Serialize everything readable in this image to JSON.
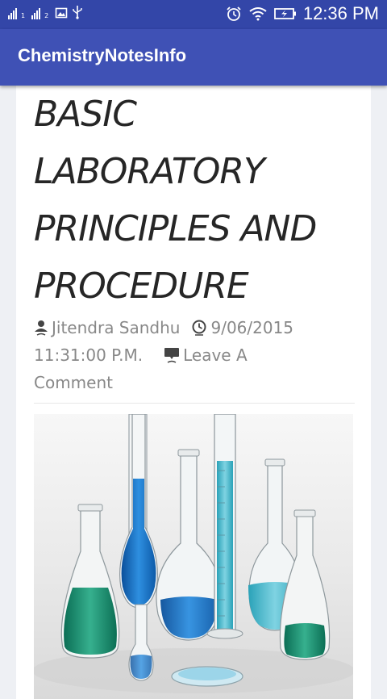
{
  "status_bar": {
    "time": "12:36 PM",
    "sim1": "1",
    "sim2": "2",
    "icons": [
      "signal-icon",
      "signal-icon",
      "image-icon",
      "usb-icon",
      "alarm-icon",
      "wifi-icon",
      "battery-charging-icon"
    ]
  },
  "app_bar": {
    "title": "ChemistryNotesInfo"
  },
  "post": {
    "title_lines": [
      "BASIC",
      "LABORATORY",
      "PRINCIPLES AND",
      "PROCEDURE"
    ],
    "author": "Jitendra Sandhu",
    "date_part1": "9/06/2015",
    "date_part2": "11:31:00 P.M.",
    "comment_part1": "Leave A",
    "comment_part2": "Comment",
    "image_subject": "laboratory glassware with blue and green liquids"
  },
  "colors": {
    "app_bar": "#3f51b5",
    "status_bar": "#3346a8",
    "title_text": "#262626",
    "meta_text": "#888888"
  }
}
